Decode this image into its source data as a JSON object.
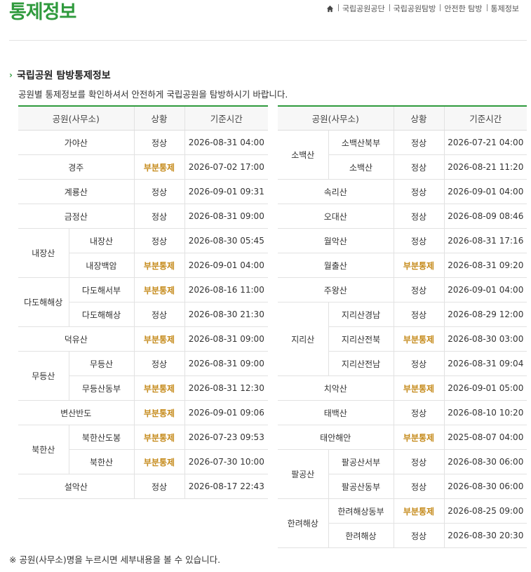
{
  "page": {
    "title": "통제정보",
    "breadcrumb": [
      "국립공원공단",
      "국립공원탐방",
      "안전한 탐방",
      "통제정보"
    ],
    "section_title": "국립공원 탐방통제정보",
    "description": "공원별 통제정보를 확인하셔서 안전하게 국립공원을 탐방하시기 바랍니다.",
    "footnote": "※ 공원(사무소)명을 누르시면 세부내용을 볼 수 있습니다."
  },
  "colors": {
    "brand": "#2f9a3d",
    "partial_control": "#c58a1a"
  },
  "table": {
    "headers": {
      "park": "공원(사무소)",
      "status": "상황",
      "time": "기준시간"
    },
    "left": [
      {
        "park": "가야산",
        "items": [
          {
            "status": "정상",
            "time": "2026-08-31 04:00"
          }
        ]
      },
      {
        "park": "경주",
        "items": [
          {
            "status": "부분통제",
            "time": "2026-07-02 17:00"
          }
        ]
      },
      {
        "park": "계룡산",
        "items": [
          {
            "status": "정상",
            "time": "2026-09-01 09:31"
          }
        ]
      },
      {
        "park": "금정산",
        "items": [
          {
            "status": "정상",
            "time": "2026-08-31 09:00"
          }
        ]
      },
      {
        "park": "내장산",
        "items": [
          {
            "sub": "내장산",
            "status": "정상",
            "time": "2026-08-30 05:45"
          },
          {
            "sub": "내장백암",
            "status": "부분통제",
            "time": "2026-09-01 04:00"
          }
        ]
      },
      {
        "park": "다도해해상",
        "items": [
          {
            "sub": "다도해서부",
            "status": "부분통제",
            "time": "2026-08-16 11:00"
          },
          {
            "sub": "다도해해상",
            "status": "정상",
            "time": "2026-08-30 21:30"
          }
        ]
      },
      {
        "park": "덕유산",
        "items": [
          {
            "status": "부분통제",
            "time": "2026-08-31 09:00"
          }
        ]
      },
      {
        "park": "무등산",
        "items": [
          {
            "sub": "무등산",
            "status": "정상",
            "time": "2026-08-31 09:00"
          },
          {
            "sub": "무등산동부",
            "status": "부분통제",
            "time": "2026-08-31 12:30"
          }
        ]
      },
      {
        "park": "변산반도",
        "items": [
          {
            "status": "부분통제",
            "time": "2026-09-01 09:06"
          }
        ]
      },
      {
        "park": "북한산",
        "items": [
          {
            "sub": "북한산도봉",
            "status": "부분통제",
            "time": "2026-07-23 09:53"
          },
          {
            "sub": "북한산",
            "status": "부분통제",
            "time": "2026-07-30 10:00"
          }
        ]
      },
      {
        "park": "설악산",
        "items": [
          {
            "status": "정상",
            "time": "2026-08-17 22:43"
          }
        ]
      }
    ],
    "right": [
      {
        "park": "소백산",
        "items": [
          {
            "sub": "소백산북부",
            "status": "정상",
            "time": "2026-07-21 04:00"
          },
          {
            "sub": "소백산",
            "status": "정상",
            "time": "2026-08-21 11:20"
          }
        ]
      },
      {
        "park": "속리산",
        "items": [
          {
            "status": "정상",
            "time": "2026-09-01 04:00"
          }
        ]
      },
      {
        "park": "오대산",
        "items": [
          {
            "status": "정상",
            "time": "2026-08-09 08:46"
          }
        ]
      },
      {
        "park": "월악산",
        "items": [
          {
            "status": "정상",
            "time": "2026-08-31 17:16"
          }
        ]
      },
      {
        "park": "월출산",
        "items": [
          {
            "status": "부분통제",
            "time": "2026-08-31 09:20"
          }
        ]
      },
      {
        "park": "주왕산",
        "items": [
          {
            "status": "정상",
            "time": "2026-09-01 04:00"
          }
        ]
      },
      {
        "park": "지리산",
        "items": [
          {
            "sub": "지리산경남",
            "status": "정상",
            "time": "2026-08-29 12:00"
          },
          {
            "sub": "지리산전북",
            "status": "부분통제",
            "time": "2026-08-30 03:00"
          },
          {
            "sub": "지리산전남",
            "status": "정상",
            "time": "2026-08-31 09:04"
          }
        ]
      },
      {
        "park": "치악산",
        "items": [
          {
            "status": "부분통제",
            "time": "2026-09-01 05:00"
          }
        ]
      },
      {
        "park": "태백산",
        "items": [
          {
            "status": "정상",
            "time": "2026-08-10 10:20"
          }
        ]
      },
      {
        "park": "태안해안",
        "items": [
          {
            "status": "부분통제",
            "time": "2025-08-07 04:00"
          }
        ]
      },
      {
        "park": "팔공산",
        "items": [
          {
            "sub": "팔공산서부",
            "status": "정상",
            "time": "2026-08-30 06:00"
          },
          {
            "sub": "팔공산동부",
            "status": "정상",
            "time": "2026-08-30 06:00"
          }
        ]
      },
      {
        "park": "한려해상",
        "items": [
          {
            "sub": "한려해상동부",
            "status": "부분통제",
            "time": "2026-08-25 09:00"
          },
          {
            "sub": "한려해상",
            "status": "정상",
            "time": "2026-08-30 20:30"
          }
        ]
      }
    ]
  }
}
